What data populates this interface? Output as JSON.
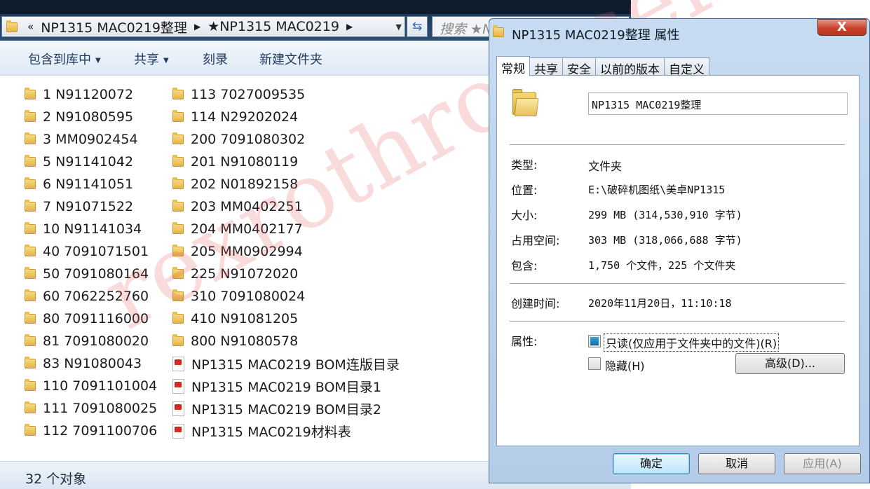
{
  "explorer": {
    "breadcrumb": {
      "overflow": "«",
      "segments": [
        "NP1315 MAC0219整理",
        "★NP1315 MAC0219"
      ],
      "search_placeholder": "搜索 ★N"
    },
    "toolbar": {
      "include_library": "包含到库中",
      "share": "共享",
      "burn": "刻录",
      "new_folder": "新建文件夹"
    },
    "files_col1": [
      {
        "name": "1  N91120072"
      },
      {
        "name": "2  N91080595"
      },
      {
        "name": "3  MM0902454"
      },
      {
        "name": "5  N91141042"
      },
      {
        "name": "6  N91141051"
      },
      {
        "name": "7  N91071522"
      },
      {
        "name": "10  N91141034"
      },
      {
        "name": "40  7091071501"
      },
      {
        "name": "50  7091080164"
      },
      {
        "name": "60  7062252760"
      },
      {
        "name": "80  7091116000"
      },
      {
        "name": "81  7091080020"
      },
      {
        "name": "83  N91080043"
      },
      {
        "name": "110  7091101004"
      },
      {
        "name": "111  7091080025"
      },
      {
        "name": "112  7091100706"
      }
    ],
    "files_col2": [
      {
        "name": "113  7027009535",
        "kind": "folder"
      },
      {
        "name": "114  N29202024",
        "kind": "folder"
      },
      {
        "name": "200  7091080302",
        "kind": "folder"
      },
      {
        "name": "201  N91080119",
        "kind": "folder"
      },
      {
        "name": "202  N01892158",
        "kind": "folder"
      },
      {
        "name": "203  MM0402251",
        "kind": "folder"
      },
      {
        "name": "204  MM0402177",
        "kind": "folder"
      },
      {
        "name": "205  MM0902994",
        "kind": "folder"
      },
      {
        "name": "225  N91072020",
        "kind": "folder"
      },
      {
        "name": "310  7091080024",
        "kind": "folder"
      },
      {
        "name": "410  N91081205",
        "kind": "folder"
      },
      {
        "name": "800  N91080578",
        "kind": "folder"
      },
      {
        "name": "NP1315 MAC0219 BOM连版目录",
        "kind": "pdf"
      },
      {
        "name": "NP1315 MAC0219 BOM目录1",
        "kind": "pdf"
      },
      {
        "name": "NP1315 MAC0219 BOM目录2",
        "kind": "pdf"
      },
      {
        "name": "NP1315 MAC0219材料表",
        "kind": "pdf"
      }
    ],
    "status": "32 个对象"
  },
  "dialog": {
    "title": "NP1315 MAC0219整理 属性",
    "close": "X",
    "tabs": [
      "常规",
      "共享",
      "安全",
      "以前的版本",
      "自定义"
    ],
    "folder_name": "NP1315 MAC0219整理",
    "labels": {
      "type": "类型:",
      "location": "位置:",
      "size": "大小:",
      "size_on_disk": "占用空间:",
      "contains": "包含:",
      "created": "创建时间:",
      "attributes": "属性:"
    },
    "values": {
      "type": "文件夹",
      "location": "E:\\破碎机图纸\\美卓NP1315",
      "size": "299 MB (314,530,910 字节)",
      "size_on_disk": "303 MB (318,066,688 字节)",
      "contains": "1,750 个文件，225 个文件夹",
      "created": "2020年11月20日，11:10:18"
    },
    "attributes": {
      "readonly_label": "只读(仅应用于文件夹中的文件)(R)",
      "readonly_state": "indeterminate",
      "hidden_label": "隐藏(H)",
      "hidden_state": "unchecked",
      "advanced": "高级(D)..."
    },
    "buttons": {
      "ok": "确定",
      "cancel": "取消",
      "apply": "应用(A)"
    }
  },
  "watermark": "rexrothrodicer"
}
